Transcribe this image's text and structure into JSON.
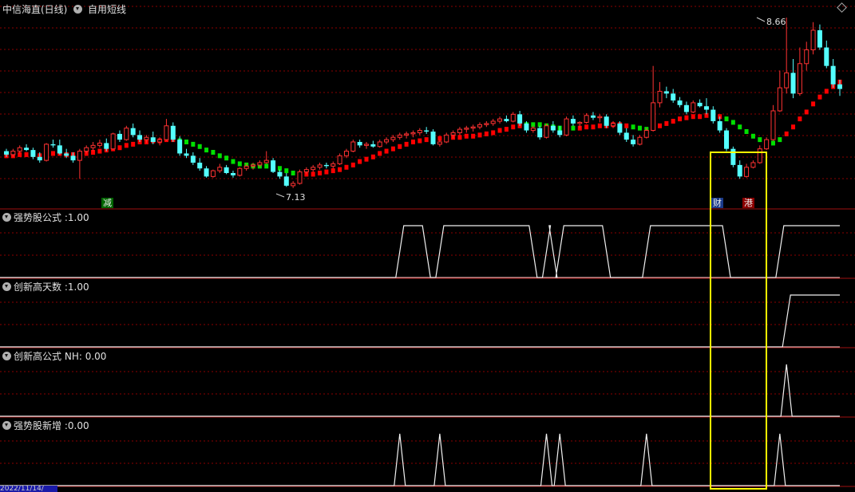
{
  "header": {
    "stock": "中信海直(日线)",
    "indicator_menu": "自用短线"
  },
  "panels": [
    {
      "label": "强势股公式",
      "value": ":1.00"
    },
    {
      "label": "创新高天数",
      "value": ":1.00"
    },
    {
      "label": "创新高公式",
      "value": "NH: 0.00"
    },
    {
      "label": "强势股新增",
      "value": ":0.00"
    }
  ],
  "annotations": {
    "high_label": "8.66",
    "low_label": "7.13",
    "tag1": "减",
    "tag2": "财",
    "tag3": "港"
  },
  "date_label": "2022/11/14/",
  "colors": {
    "up": "#ff3232",
    "down": "#54ffff",
    "ma_up": "#ff0000",
    "ma_down": "#00e000",
    "highlight": "#ffff00",
    "grid": "#8b0000"
  },
  "chart_data": {
    "type": "candlestick",
    "x_start_date": "2022/11/14",
    "y_price_markers": {
      "high": 8.66,
      "low": 7.13
    },
    "candles_ohlc": [
      [
        7.5,
        7.52,
        7.45,
        7.47
      ],
      [
        7.47,
        7.52,
        7.45,
        7.5
      ],
      [
        7.5,
        7.55,
        7.48,
        7.53
      ],
      [
        7.53,
        7.56,
        7.5,
        7.51
      ],
      [
        7.51,
        7.53,
        7.43,
        7.45
      ],
      [
        7.45,
        7.49,
        7.4,
        7.42
      ],
      [
        7.42,
        7.57,
        7.41,
        7.56
      ],
      [
        7.56,
        7.6,
        7.53,
        7.55
      ],
      [
        7.55,
        7.6,
        7.47,
        7.48
      ],
      [
        7.48,
        7.52,
        7.44,
        7.46
      ],
      [
        7.46,
        7.49,
        7.4,
        7.42
      ],
      [
        7.42,
        7.52,
        7.26,
        7.5
      ],
      [
        7.5,
        7.55,
        7.48,
        7.53
      ],
      [
        7.53,
        7.58,
        7.5,
        7.55
      ],
      [
        7.55,
        7.6,
        7.53,
        7.57
      ],
      [
        7.57,
        7.61,
        7.5,
        7.52
      ],
      [
        7.52,
        7.66,
        7.51,
        7.65
      ],
      [
        7.65,
        7.68,
        7.58,
        7.6
      ],
      [
        7.6,
        7.72,
        7.59,
        7.7
      ],
      [
        7.7,
        7.74,
        7.62,
        7.64
      ],
      [
        7.64,
        7.68,
        7.58,
        7.6
      ],
      [
        7.6,
        7.64,
        7.57,
        7.62
      ],
      [
        7.62,
        7.67,
        7.56,
        7.58
      ],
      [
        7.58,
        7.62,
        7.55,
        7.6
      ],
      [
        7.6,
        7.78,
        7.59,
        7.72
      ],
      [
        7.72,
        7.75,
        7.58,
        7.6
      ],
      [
        7.6,
        7.63,
        7.46,
        7.48
      ],
      [
        7.48,
        7.52,
        7.44,
        7.46
      ],
      [
        7.46,
        7.49,
        7.38,
        7.4
      ],
      [
        7.4,
        7.44,
        7.33,
        7.35
      ],
      [
        7.35,
        7.37,
        7.27,
        7.28
      ],
      [
        7.28,
        7.34,
        7.27,
        7.33
      ],
      [
        7.33,
        7.39,
        7.31,
        7.36
      ],
      [
        7.36,
        7.38,
        7.3,
        7.31
      ],
      [
        7.31,
        7.33,
        7.27,
        7.29
      ],
      [
        7.29,
        7.36,
        7.28,
        7.35
      ],
      [
        7.35,
        7.39,
        7.33,
        7.37
      ],
      [
        7.37,
        7.4,
        7.34,
        7.38
      ],
      [
        7.38,
        7.42,
        7.36,
        7.4
      ],
      [
        7.4,
        7.5,
        7.39,
        7.42
      ],
      [
        7.42,
        7.44,
        7.31,
        7.32
      ],
      [
        7.32,
        7.34,
        7.26,
        7.28
      ],
      [
        7.28,
        7.31,
        7.19,
        7.2
      ],
      [
        7.2,
        7.24,
        7.18,
        7.22
      ],
      [
        7.22,
        7.34,
        7.21,
        7.32
      ],
      [
        7.32,
        7.36,
        7.3,
        7.34
      ],
      [
        7.34,
        7.38,
        7.32,
        7.36
      ],
      [
        7.36,
        7.4,
        7.34,
        7.38
      ],
      [
        7.38,
        7.4,
        7.35,
        7.37
      ],
      [
        7.37,
        7.41,
        7.35,
        7.39
      ],
      [
        7.39,
        7.48,
        7.38,
        7.46
      ],
      [
        7.46,
        7.52,
        7.44,
        7.5
      ],
      [
        7.5,
        7.6,
        7.49,
        7.58
      ],
      [
        7.58,
        7.6,
        7.53,
        7.55
      ],
      [
        7.55,
        7.58,
        7.52,
        7.56
      ],
      [
        7.56,
        7.59,
        7.53,
        7.54
      ],
      [
        7.54,
        7.6,
        7.53,
        7.58
      ],
      [
        7.58,
        7.62,
        7.56,
        7.6
      ],
      [
        7.6,
        7.64,
        7.58,
        7.62
      ],
      [
        7.62,
        7.66,
        7.6,
        7.64
      ],
      [
        7.64,
        7.67,
        7.61,
        7.65
      ],
      [
        7.65,
        7.68,
        7.62,
        7.66
      ],
      [
        7.66,
        7.7,
        7.64,
        7.68
      ],
      [
        7.68,
        7.71,
        7.65,
        7.67
      ],
      [
        7.67,
        7.69,
        7.55,
        7.56
      ],
      [
        7.56,
        7.6,
        7.54,
        7.58
      ],
      [
        7.58,
        7.66,
        7.57,
        7.64
      ],
      [
        7.64,
        7.68,
        7.61,
        7.66
      ],
      [
        7.66,
        7.71,
        7.64,
        7.69
      ],
      [
        7.69,
        7.72,
        7.66,
        7.7
      ],
      [
        7.7,
        7.73,
        7.67,
        7.71
      ],
      [
        7.71,
        7.75,
        7.69,
        7.73
      ],
      [
        7.73,
        7.76,
        7.71,
        7.74
      ],
      [
        7.74,
        7.78,
        7.72,
        7.76
      ],
      [
        7.76,
        7.8,
        7.74,
        7.78
      ],
      [
        7.78,
        7.81,
        7.75,
        7.76
      ],
      [
        7.76,
        7.84,
        7.75,
        7.82
      ],
      [
        7.82,
        7.85,
        7.72,
        7.74
      ],
      [
        7.74,
        7.76,
        7.66,
        7.68
      ],
      [
        7.68,
        7.72,
        7.66,
        7.7
      ],
      [
        7.7,
        7.72,
        7.6,
        7.62
      ],
      [
        7.62,
        7.74,
        7.61,
        7.72
      ],
      [
        7.72,
        7.76,
        7.66,
        7.68
      ],
      [
        7.68,
        7.72,
        7.62,
        7.64
      ],
      [
        7.64,
        7.8,
        7.63,
        7.78
      ],
      [
        7.78,
        7.81,
        7.72,
        7.74
      ],
      [
        7.74,
        7.76,
        7.7,
        7.75
      ],
      [
        7.75,
        7.83,
        7.74,
        7.81
      ],
      [
        7.81,
        7.84,
        7.77,
        7.79
      ],
      [
        7.79,
        7.82,
        7.75,
        7.8
      ],
      [
        7.8,
        7.82,
        7.7,
        7.72
      ],
      [
        7.72,
        7.76,
        7.7,
        7.74
      ],
      [
        7.74,
        7.76,
        7.64,
        7.66
      ],
      [
        7.66,
        7.7,
        7.58,
        7.6
      ],
      [
        7.6,
        7.64,
        7.54,
        7.56
      ],
      [
        7.56,
        7.64,
        7.55,
        7.62
      ],
      [
        7.62,
        7.7,
        7.61,
        7.68
      ],
      [
        7.68,
        8.24,
        7.67,
        7.92
      ],
      [
        7.92,
        8.1,
        7.88,
        8.02
      ],
      [
        8.02,
        8.06,
        7.96,
        8.0
      ],
      [
        8.0,
        8.04,
        7.92,
        7.94
      ],
      [
        7.94,
        7.97,
        7.88,
        7.9
      ],
      [
        7.9,
        7.93,
        7.82,
        7.84
      ],
      [
        7.84,
        7.94,
        7.83,
        7.92
      ],
      [
        7.92,
        7.95,
        7.88,
        7.89
      ],
      [
        7.89,
        7.96,
        7.82,
        7.86
      ],
      [
        7.86,
        7.89,
        7.74,
        7.76
      ],
      [
        7.76,
        7.8,
        7.66,
        7.68
      ],
      [
        7.68,
        7.7,
        7.5,
        7.52
      ],
      [
        7.52,
        7.54,
        7.36,
        7.38
      ],
      [
        7.38,
        7.42,
        7.26,
        7.28
      ],
      [
        7.28,
        7.39,
        7.27,
        7.36
      ],
      [
        7.36,
        7.42,
        7.35,
        7.4
      ],
      [
        7.4,
        7.55,
        7.39,
        7.52
      ],
      [
        7.52,
        7.62,
        7.51,
        7.6
      ],
      [
        7.6,
        7.9,
        7.59,
        7.85
      ],
      [
        7.85,
        8.2,
        7.84,
        8.05
      ],
      [
        8.05,
        8.66,
        8.0,
        8.18
      ],
      [
        8.18,
        8.3,
        7.96,
        8.0
      ],
      [
        8.0,
        8.4,
        7.98,
        8.26
      ],
      [
        8.26,
        8.45,
        8.2,
        8.38
      ],
      [
        8.38,
        8.62,
        8.34,
        8.55
      ],
      [
        8.55,
        8.6,
        8.38,
        8.4
      ],
      [
        8.4,
        8.46,
        8.22,
        8.24
      ],
      [
        8.24,
        8.3,
        8.05,
        8.08
      ],
      [
        8.08,
        8.12,
        7.98,
        8.04
      ]
    ],
    "ma_line": [
      7.46,
      7.46,
      7.47,
      7.47,
      7.47,
      7.46,
      7.47,
      7.48,
      7.48,
      7.47,
      7.47,
      7.47,
      7.48,
      7.49,
      7.5,
      7.51,
      7.52,
      7.53,
      7.55,
      7.56,
      7.58,
      7.58,
      7.59,
      7.59,
      7.6,
      7.6,
      7.59,
      7.58,
      7.56,
      7.54,
      7.51,
      7.49,
      7.46,
      7.44,
      7.41,
      7.39,
      7.38,
      7.37,
      7.37,
      7.37,
      7.36,
      7.35,
      7.33,
      7.31,
      7.3,
      7.3,
      7.3,
      7.31,
      7.32,
      7.33,
      7.34,
      7.36,
      7.38,
      7.41,
      7.43,
      7.45,
      7.48,
      7.5,
      7.52,
      7.54,
      7.56,
      7.58,
      7.59,
      7.6,
      7.61,
      7.61,
      7.62,
      7.62,
      7.62,
      7.63,
      7.63,
      7.64,
      7.65,
      7.66,
      7.68,
      7.69,
      7.71,
      7.72,
      7.73,
      7.73,
      7.73,
      7.72,
      7.71,
      7.7,
      7.7,
      7.7,
      7.7,
      7.71,
      7.71,
      7.72,
      7.72,
      7.73,
      7.73,
      7.72,
      7.71,
      7.7,
      7.69,
      7.7,
      7.72,
      7.74,
      7.76,
      7.78,
      7.79,
      7.8,
      7.8,
      7.81,
      7.81,
      7.8,
      7.78,
      7.75,
      7.71,
      7.67,
      7.63,
      7.6,
      7.57,
      7.57,
      7.6,
      7.65,
      7.71,
      7.78,
      7.84,
      7.91,
      7.97,
      8.02,
      8.06,
      8.1
    ],
    "ma_trend_up": [
      1,
      1,
      1,
      1,
      1,
      1,
      1,
      1,
      1,
      1,
      1,
      1,
      1,
      1,
      1,
      1,
      1,
      1,
      1,
      1,
      1,
      1,
      1,
      1,
      1,
      1,
      0,
      0,
      0,
      0,
      0,
      0,
      0,
      0,
      0,
      0,
      0,
      0,
      0,
      0,
      0,
      0,
      0,
      0,
      0,
      1,
      1,
      1,
      1,
      1,
      1,
      1,
      1,
      1,
      1,
      1,
      1,
      1,
      1,
      1,
      1,
      1,
      1,
      1,
      1,
      1,
      1,
      1,
      1,
      1,
      1,
      1,
      1,
      1,
      1,
      1,
      1,
      1,
      0,
      0,
      0,
      0,
      0,
      0,
      0,
      0,
      1,
      1,
      1,
      1,
      1,
      1,
      1,
      1,
      0,
      0,
      0,
      1,
      1,
      1,
      1,
      1,
      1,
      1,
      1,
      1,
      1,
      1,
      0,
      0,
      0,
      0,
      0,
      0,
      0,
      0,
      0,
      1,
      1,
      1,
      1,
      1,
      1,
      1,
      1,
      1,
      1,
      1,
      0,
      0
    ],
    "indicators": {
      "strong_stock_formula": {
        "name": "强势股公式",
        "segments_on": [
          [
            59,
            63
          ],
          [
            65,
            79
          ],
          [
            81,
            82
          ],
          [
            83,
            90
          ],
          [
            96,
            108
          ],
          [
            116,
            131
          ]
        ]
      },
      "new_high_days": {
        "name": "创新高天数",
        "segments_on": [
          [
            117,
            131
          ]
        ]
      },
      "new_high_formula": {
        "name": "创新高公式",
        "pulses": [
          117
        ]
      },
      "strong_stock_new": {
        "name": "强势股新增",
        "pulses": [
          59,
          65,
          81,
          83,
          96,
          116
        ]
      }
    }
  }
}
